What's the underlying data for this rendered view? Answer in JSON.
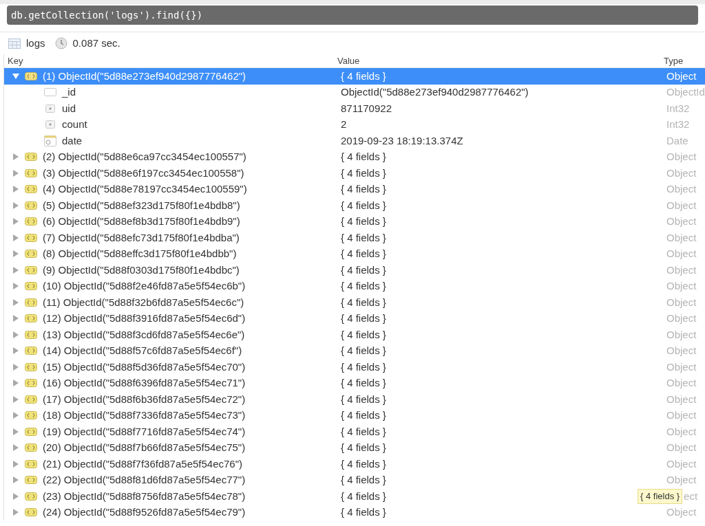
{
  "query": {
    "text": "db.getCollection('logs').find({})"
  },
  "result_bar": {
    "collection": "logs",
    "time": "0.087 sec."
  },
  "table": {
    "columns": [
      "Key",
      "Value",
      "Type"
    ],
    "rows": [
      {
        "key": "(1) ObjectId(\"5d88e273ef940d2987776462\")",
        "value": "{ 4 fields }",
        "type": "Object",
        "selected": true,
        "expanded": true,
        "children": [
          {
            "kind": "id",
            "key": "_id",
            "value": "ObjectId(\"5d88e273ef940d2987776462\")",
            "type": "ObjectId"
          },
          {
            "kind": "int",
            "key": "uid",
            "value": "871170922",
            "type": "Int32"
          },
          {
            "kind": "int",
            "key": "count",
            "value": "2",
            "type": "Int32"
          },
          {
            "kind": "date",
            "key": "date",
            "value": "2019-09-23 18:19:13.374Z",
            "type": "Date"
          }
        ]
      },
      {
        "key": "(2) ObjectId(\"5d88e6ca97cc3454ec100557\")",
        "value": "{ 4 fields }",
        "type": "Object",
        "selected": false,
        "expanded": false
      },
      {
        "key": "(3) ObjectId(\"5d88e6f197cc3454ec100558\")",
        "value": "{ 4 fields }",
        "type": "Object",
        "selected": false,
        "expanded": false
      },
      {
        "key": "(4) ObjectId(\"5d88e78197cc3454ec100559\")",
        "value": "{ 4 fields }",
        "type": "Object",
        "selected": false,
        "expanded": false
      },
      {
        "key": "(5) ObjectId(\"5d88ef323d175f80f1e4bdb8\")",
        "value": "{ 4 fields }",
        "type": "Object",
        "selected": false,
        "expanded": false
      },
      {
        "key": "(6) ObjectId(\"5d88ef8b3d175f80f1e4bdb9\")",
        "value": "{ 4 fields }",
        "type": "Object",
        "selected": false,
        "expanded": false
      },
      {
        "key": "(7) ObjectId(\"5d88efc73d175f80f1e4bdba\")",
        "value": "{ 4 fields }",
        "type": "Object",
        "selected": false,
        "expanded": false
      },
      {
        "key": "(8) ObjectId(\"5d88effc3d175f80f1e4bdbb\")",
        "value": "{ 4 fields }",
        "type": "Object",
        "selected": false,
        "expanded": false
      },
      {
        "key": "(9) ObjectId(\"5d88f0303d175f80f1e4bdbc\")",
        "value": "{ 4 fields }",
        "type": "Object",
        "selected": false,
        "expanded": false
      },
      {
        "key": "(10) ObjectId(\"5d88f2e46fd87a5e5f54ec6b\")",
        "value": "{ 4 fields }",
        "type": "Object",
        "selected": false,
        "expanded": false
      },
      {
        "key": "(11) ObjectId(\"5d88f32b6fd87a5e5f54ec6c\")",
        "value": "{ 4 fields }",
        "type": "Object",
        "selected": false,
        "expanded": false
      },
      {
        "key": "(12) ObjectId(\"5d88f3916fd87a5e5f54ec6d\")",
        "value": "{ 4 fields }",
        "type": "Object",
        "selected": false,
        "expanded": false
      },
      {
        "key": "(13) ObjectId(\"5d88f3cd6fd87a5e5f54ec6e\")",
        "value": "{ 4 fields }",
        "type": "Object",
        "selected": false,
        "expanded": false
      },
      {
        "key": "(14) ObjectId(\"5d88f57c6fd87a5e5f54ec6f\")",
        "value": "{ 4 fields }",
        "type": "Object",
        "selected": false,
        "expanded": false
      },
      {
        "key": "(15) ObjectId(\"5d88f5d36fd87a5e5f54ec70\")",
        "value": "{ 4 fields }",
        "type": "Object",
        "selected": false,
        "expanded": false
      },
      {
        "key": "(16) ObjectId(\"5d88f6396fd87a5e5f54ec71\")",
        "value": "{ 4 fields }",
        "type": "Object",
        "selected": false,
        "expanded": false
      },
      {
        "key": "(17) ObjectId(\"5d88f6b36fd87a5e5f54ec72\")",
        "value": "{ 4 fields }",
        "type": "Object",
        "selected": false,
        "expanded": false
      },
      {
        "key": "(18) ObjectId(\"5d88f7336fd87a5e5f54ec73\")",
        "value": "{ 4 fields }",
        "type": "Object",
        "selected": false,
        "expanded": false
      },
      {
        "key": "(19) ObjectId(\"5d88f7716fd87a5e5f54ec74\")",
        "value": "{ 4 fields }",
        "type": "Object",
        "selected": false,
        "expanded": false
      },
      {
        "key": "(20) ObjectId(\"5d88f7b66fd87a5e5f54ec75\")",
        "value": "{ 4 fields }",
        "type": "Object",
        "selected": false,
        "expanded": false
      },
      {
        "key": "(21) ObjectId(\"5d88f7f36fd87a5e5f54ec76\")",
        "value": "{ 4 fields }",
        "type": "Object",
        "selected": false,
        "expanded": false
      },
      {
        "key": "(22) ObjectId(\"5d88f81d6fd87a5e5f54ec77\")",
        "value": "{ 4 fields }",
        "type": "Object",
        "selected": false,
        "expanded": false
      },
      {
        "key": "(23) ObjectId(\"5d88f8756fd87a5e5f54ec78\")",
        "value": "{ 4 fields }",
        "type": "ect",
        "tooltip": "{ 4 fields }",
        "selected": false,
        "expanded": false
      },
      {
        "key": "(24) ObjectId(\"5d88f9526fd87a5e5f54ec79\")",
        "value": "{ 4 fields }",
        "type": "Object",
        "selected": false,
        "expanded": false
      }
    ]
  }
}
